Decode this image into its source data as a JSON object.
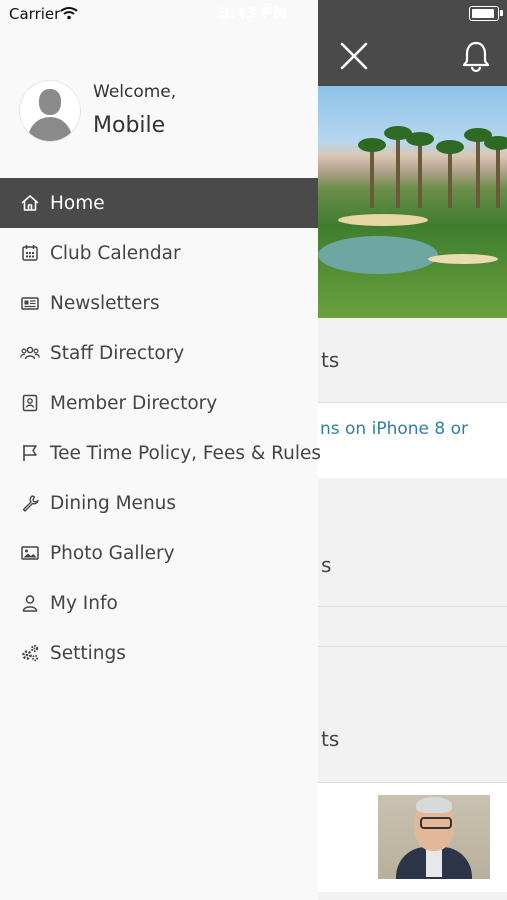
{
  "status_bar": {
    "carrier": "Carrier",
    "time": "3:43 PM"
  },
  "drawer": {
    "welcome_label": "Welcome,",
    "user_name": "Mobile",
    "menu_items": [
      {
        "label": "Home",
        "icon": "home-icon",
        "active": true
      },
      {
        "label": "Club Calendar",
        "icon": "calendar-icon",
        "active": false
      },
      {
        "label": "Newsletters",
        "icon": "newspaper-icon",
        "active": false
      },
      {
        "label": "Staff Directory",
        "icon": "users-icon",
        "active": false
      },
      {
        "label": "Member Directory",
        "icon": "contact-card-icon",
        "active": false
      },
      {
        "label": "Tee Time Policy, Fees & Rules",
        "icon": "flag-icon",
        "active": false
      },
      {
        "label": "Dining Menus",
        "icon": "wrench-icon",
        "active": false
      },
      {
        "label": "Photo Gallery",
        "icon": "image-icon",
        "active": false
      },
      {
        "label": "My Info",
        "icon": "user-icon",
        "active": false
      },
      {
        "label": "Settings",
        "icon": "gears-icon",
        "active": false
      }
    ]
  },
  "background": {
    "header_icons": [
      "close-icon",
      "bell-icon"
    ],
    "section_1_fragment": "ts",
    "link_fragment": "ns on iPhone 8 or",
    "section_2_fragment": "s",
    "section_3_fragment": "ts"
  },
  "colors": {
    "header_bg": "#4a4a4a",
    "active_item_bg": "#4a4a4a",
    "drawer_bg": "#f9f9f9",
    "link_color": "#2f7fa0"
  }
}
